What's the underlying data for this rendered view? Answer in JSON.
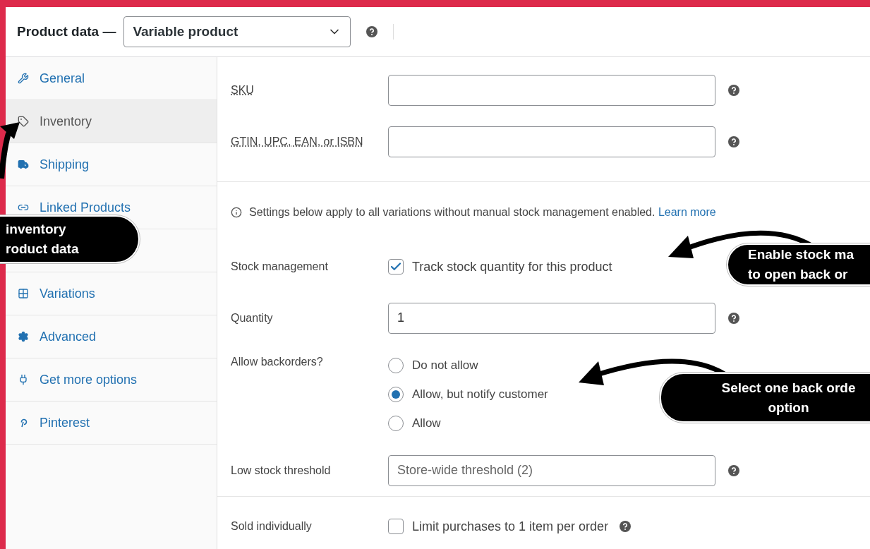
{
  "header": {
    "title": "Product data —",
    "product_type": "Variable product"
  },
  "tabs": [
    {
      "label": "General",
      "selected": false
    },
    {
      "label": "Inventory",
      "selected": true
    },
    {
      "label": "Shipping",
      "selected": false
    },
    {
      "label": "Linked Products",
      "selected": false
    },
    {
      "label": "Variations",
      "selected": false
    },
    {
      "label": "Advanced",
      "selected": false
    },
    {
      "label": "Get more options",
      "selected": false
    },
    {
      "label": "Pinterest",
      "selected": false
    }
  ],
  "sections": [
    {
      "rows": [
        {
          "kind": "input",
          "label": "SKU"
        },
        {
          "kind": "input",
          "label": "GTIN, UPC, EAN, or ISBN"
        }
      ]
    },
    {
      "rows": [
        {
          "kind": "notice",
          "text": "Settings below apply to all variations without manual stock management enabled.",
          "link": "Learn more"
        },
        {
          "kind": "checkbox",
          "label": "Stock management",
          "text": "Track stock quantity for this product",
          "checked": true,
          "help": false
        },
        {
          "kind": "input",
          "label": "Quantity",
          "value": "1"
        },
        {
          "kind": "radio",
          "label": "Allow backorders?",
          "options": [
            {
              "label": "Do not allow",
              "selected": false
            },
            {
              "label": "Allow, but notify customer",
              "selected": true
            },
            {
              "label": "Allow",
              "selected": false
            }
          ]
        },
        {
          "kind": "input",
          "label": "Low stock threshold",
          "placeholder": "Store-wide threshold (2)"
        }
      ]
    },
    {
      "rows": [
        {
          "kind": "checkbox",
          "label": "Sold individually",
          "text": "Limit purchases to 1 item per order",
          "checked": false,
          "help": true
        }
      ]
    }
  ],
  "callouts": [
    {
      "lines": [
        "inventory",
        "roduct data"
      ]
    },
    {
      "lines": [
        "Enable stock ma",
        "to open back or"
      ]
    },
    {
      "lines": [
        "Select one back orde",
        "option"
      ]
    }
  ]
}
